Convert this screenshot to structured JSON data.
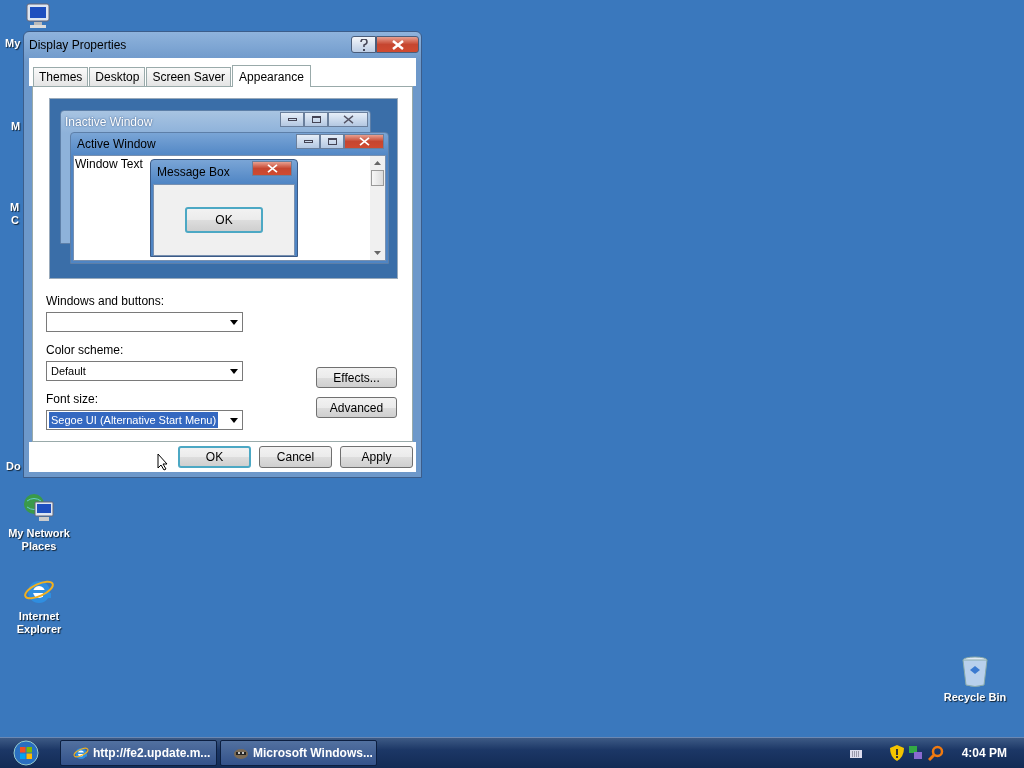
{
  "desktop": {
    "icons": [
      {
        "kind": "computer",
        "label": "My"
      },
      {
        "kind": "none",
        "label": "M"
      },
      {
        "kind": "none",
        "label": "M"
      },
      {
        "kind": "none",
        "label": "C"
      },
      {
        "kind": "none",
        "label": "Do"
      },
      {
        "kind": "network",
        "label": "My Network Places"
      },
      {
        "kind": "browser",
        "label": "Internet Explorer"
      },
      {
        "kind": "recycle",
        "label": "Recycle Bin"
      }
    ]
  },
  "dialog": {
    "title": "Display Properties",
    "tabs": [
      {
        "label": "Themes",
        "selected": false
      },
      {
        "label": "Desktop",
        "selected": false
      },
      {
        "label": "Screen Saver",
        "selected": false
      },
      {
        "label": "Appearance",
        "selected": true
      }
    ],
    "preview": {
      "inactive_title": "Inactive Window",
      "active_title": "Active Window",
      "window_text": "Window Text",
      "message_title": "Message Box",
      "message_button": "OK"
    },
    "fields": [
      {
        "label": "Windows and buttons:"
      },
      {
        "label": "Color scheme:",
        "value": "Default"
      },
      {
        "label": "Font size:",
        "value": "Segoe UI (Alternative Start Menu)",
        "highlighted": true
      }
    ],
    "side_buttons": [
      "Effects...",
      "Advanced"
    ],
    "buttons": [
      {
        "label": "OK",
        "default": true
      },
      {
        "label": "Cancel",
        "default": false
      },
      {
        "label": "Apply",
        "default": false
      }
    ]
  },
  "taskbar": {
    "tasks": [
      {
        "kind": "browser",
        "label": "http://fe2.update.m..."
      },
      {
        "kind": "tool",
        "label": "Microsoft Windows..."
      }
    ],
    "clock": "4:04 PM"
  }
}
